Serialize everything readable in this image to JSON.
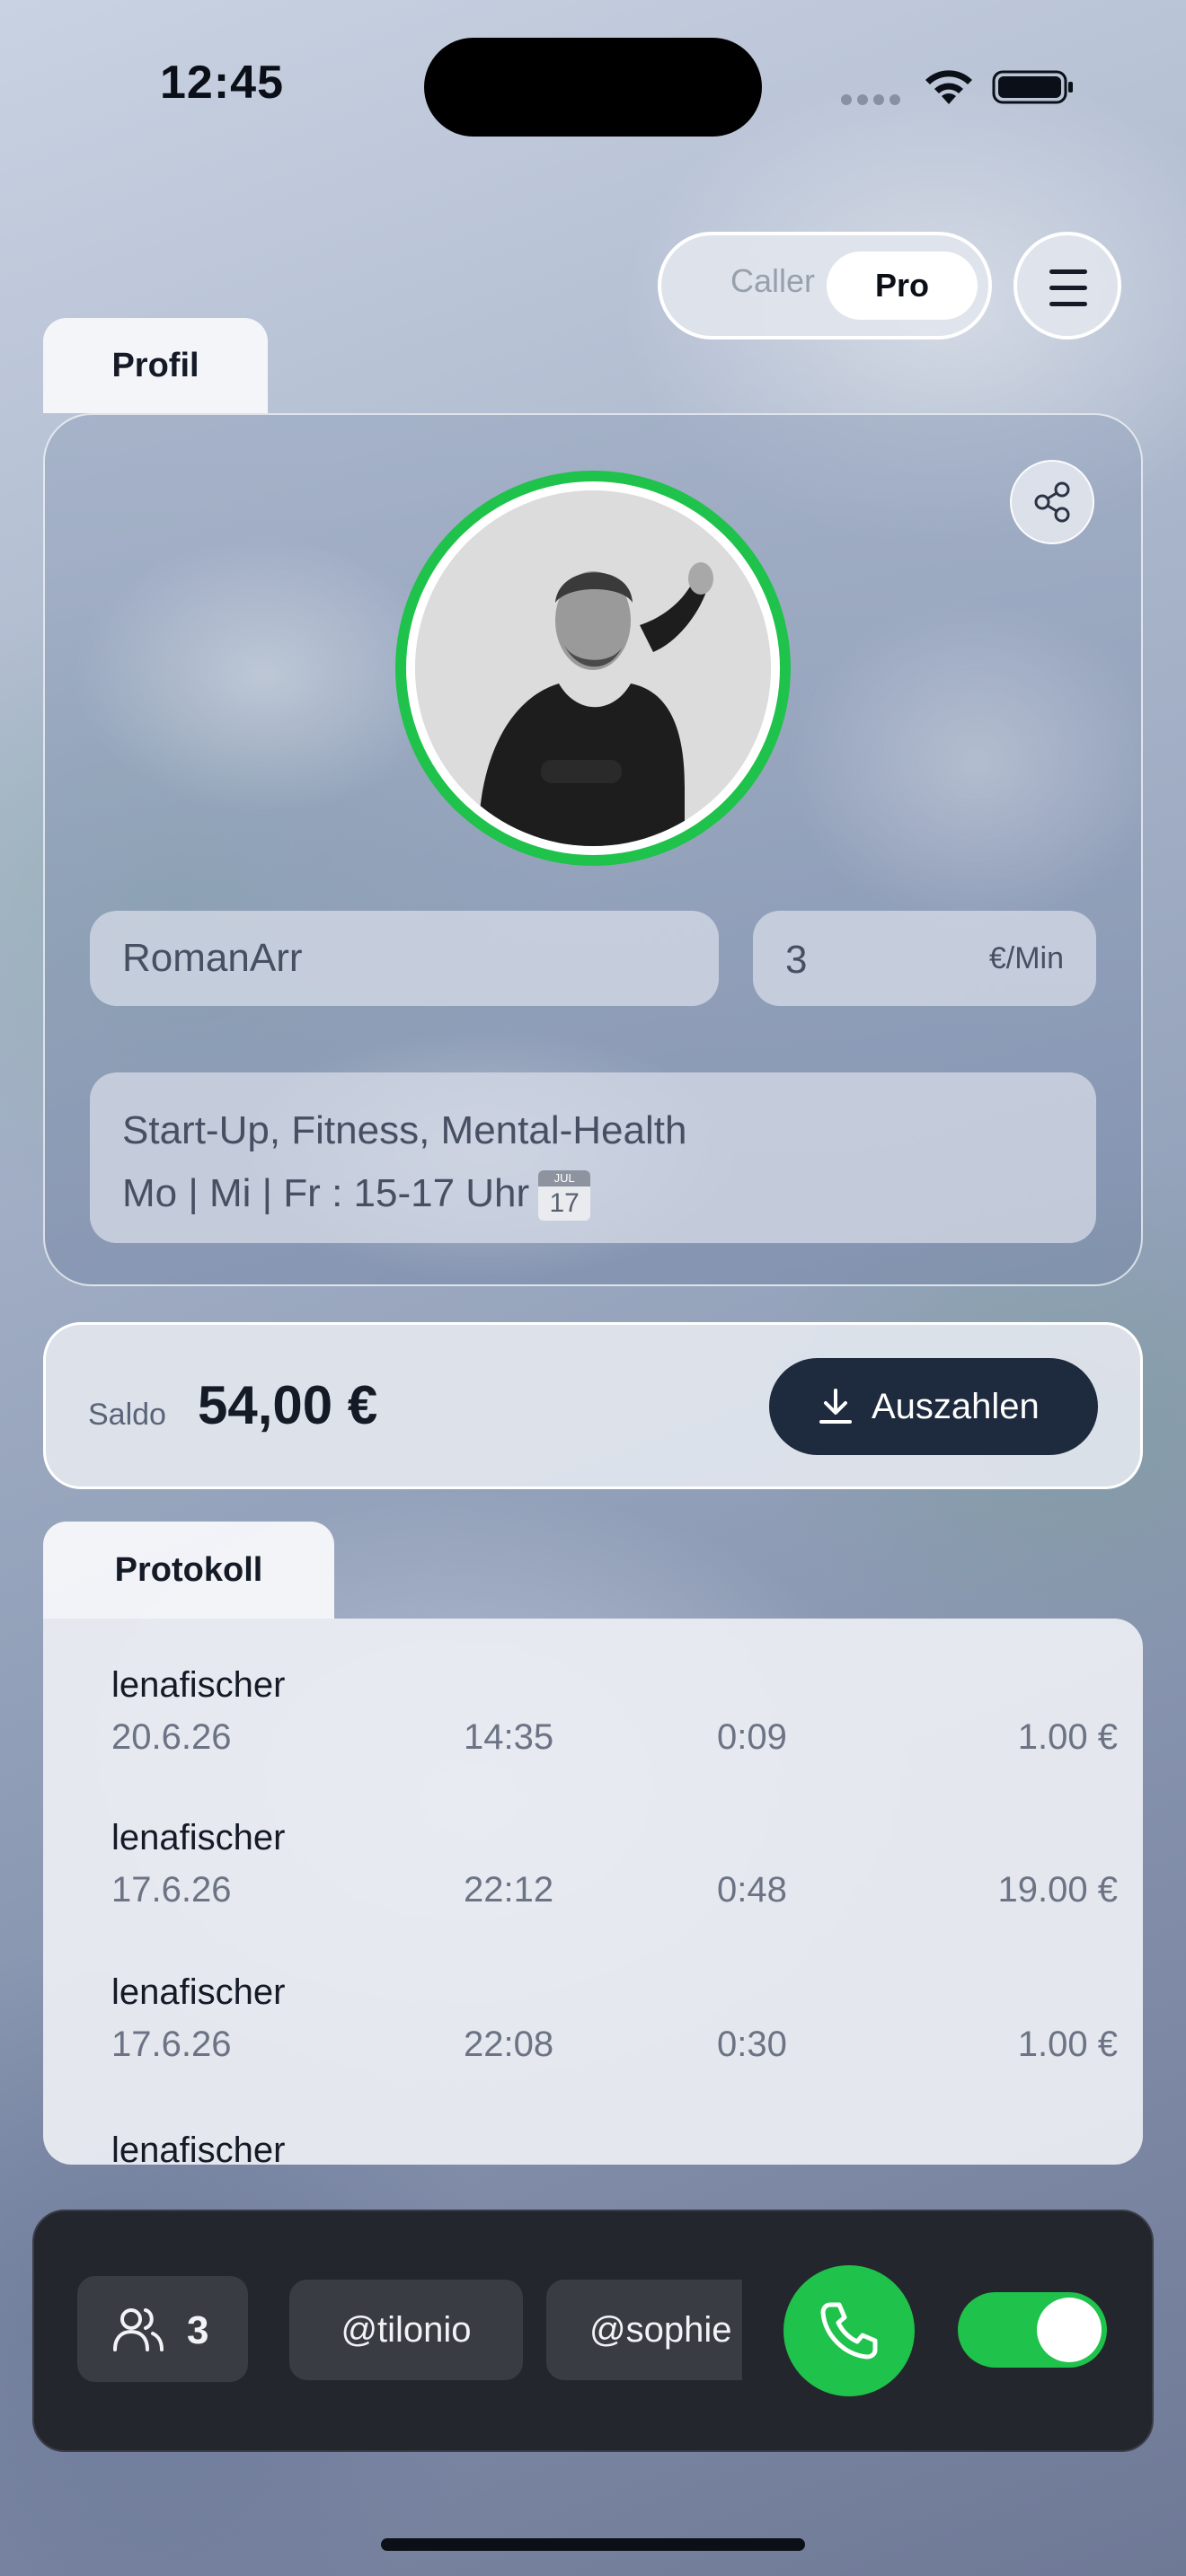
{
  "status_bar": {
    "time": "12:45"
  },
  "mode_toggle": {
    "caller_label": "Caller",
    "pro_label": "Pro",
    "selected": "Pro"
  },
  "profile": {
    "tab_label": "Profil",
    "username": "RomanArr",
    "rate_value": "3",
    "rate_unit": "€/Min",
    "bio_line1": "Start-Up, Fitness, Mental-Health",
    "bio_line2": "Mo | Mi | Fr : 15-17 Uhr",
    "calendar_emoji_month": "JUL",
    "calendar_emoji_day": "17",
    "avatar_ring_color": "#1fc24b"
  },
  "balance": {
    "label": "Saldo",
    "value": "54,00 €",
    "payout_label": "Auszahlen"
  },
  "protocol": {
    "tab_label": "Protokoll",
    "rows": [
      {
        "user": "lenafischer",
        "date": "20.6.26",
        "time": "14:35",
        "duration": "0:09",
        "amount": "1.00 €"
      },
      {
        "user": "lenafischer",
        "date": "17.6.26",
        "time": "22:12",
        "duration": "0:48",
        "amount": "19.00 €"
      },
      {
        "user": "lenafischer",
        "date": "17.6.26",
        "time": "22:08",
        "duration": "0:30",
        "amount": "1.00 €"
      },
      {
        "user": "lenafischer",
        "date": "",
        "time": "",
        "duration": "",
        "amount": ""
      }
    ]
  },
  "bottom_bar": {
    "people_count": "3",
    "chips": [
      "@tilonio",
      "@sophie"
    ],
    "call_icon": "phone-icon",
    "toggle_on": true,
    "accent_color": "#1fc24b"
  }
}
